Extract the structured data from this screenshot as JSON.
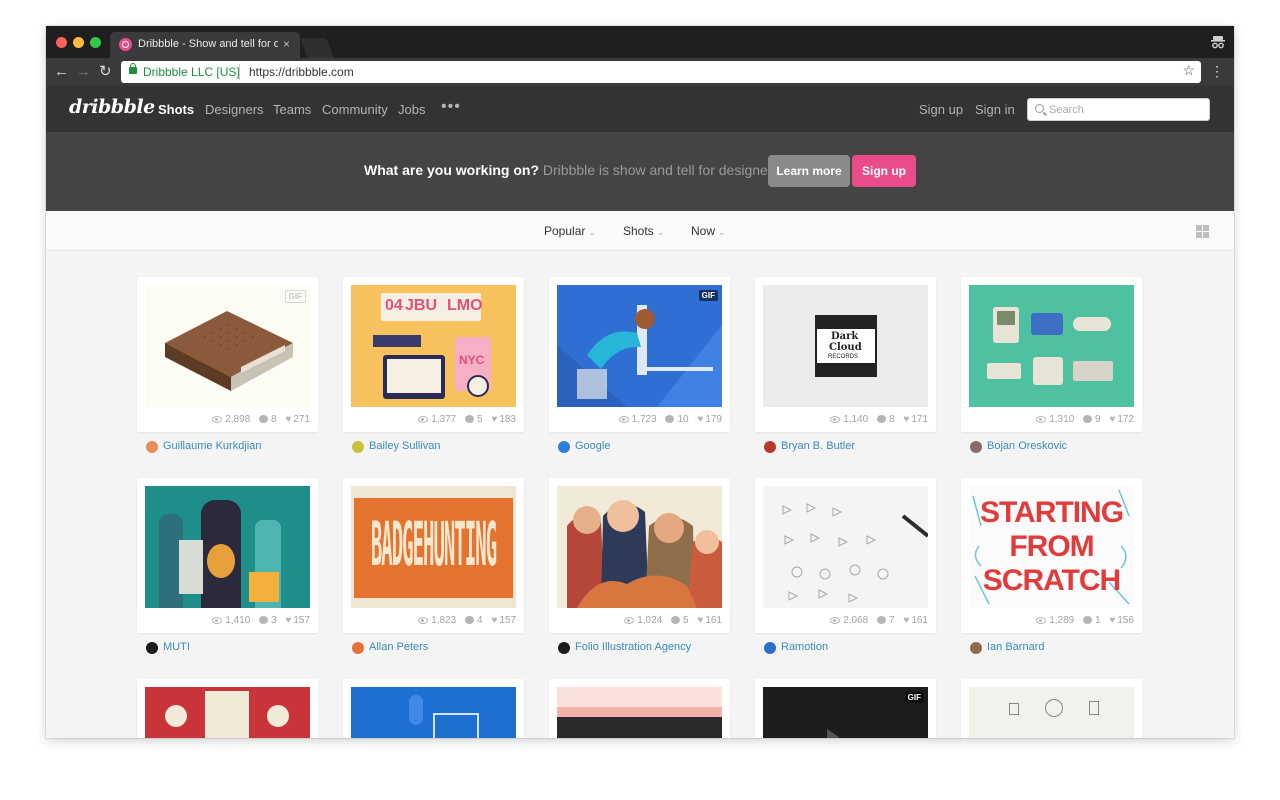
{
  "browser": {
    "tab_title": "Dribbble - Show and tell for de",
    "tab_close": "×",
    "url_owner": "Dribbble LLC [US]",
    "url": "https://dribbble.com",
    "back": "←",
    "forward": "→",
    "reload": "↻",
    "star": "☆",
    "menu": "⋮"
  },
  "header": {
    "logo": "dribbble",
    "nav": [
      "Shots",
      "Designers",
      "Teams",
      "Community",
      "Jobs"
    ],
    "more": "•••",
    "sign_up": "Sign up",
    "sign_in": "Sign in",
    "search_placeholder": "Search"
  },
  "hero": {
    "strong": "What are you working on?",
    "text": " Dribbble is show and tell for designers.",
    "learn_more": "Learn more",
    "sign_up": "Sign up"
  },
  "filters": {
    "sort": "Popular",
    "type": "Shots",
    "time": "Now",
    "caret": "⌄"
  },
  "gif_label": "GIF",
  "shots": [
    {
      "views": "2,898",
      "comments": "8",
      "likes": "271",
      "author": "Guillaume Kurkdjian",
      "gif": true,
      "avatar": "#e58e5a"
    },
    {
      "views": "1,377",
      "comments": "5",
      "likes": "183",
      "author": "Bailey Sullivan",
      "gif": false,
      "avatar": "#c9c23a"
    },
    {
      "views": "1,723",
      "comments": "10",
      "likes": "179",
      "author": "Google",
      "gif": true,
      "avatar": "#2f7fd6"
    },
    {
      "views": "1,140",
      "comments": "8",
      "likes": "171",
      "author": "Bryan B. Butler",
      "gif": false,
      "avatar": "#b43b2c"
    },
    {
      "views": "1,310",
      "comments": "9",
      "likes": "172",
      "author": "Bojan Oreskovic",
      "gif": false,
      "avatar": "#8c6a6a"
    },
    {
      "views": "1,410",
      "comments": "3",
      "likes": "157",
      "author": "MUTI",
      "gif": false,
      "avatar": "#1b1b1b"
    },
    {
      "views": "1,823",
      "comments": "4",
      "likes": "157",
      "author": "Allan Peters",
      "gif": false,
      "avatar": "#e8713a"
    },
    {
      "views": "1,024",
      "comments": "5",
      "likes": "161",
      "author": "Folio Illustration Agency",
      "gif": false,
      "avatar": "#1d1d1d"
    },
    {
      "views": "2,068",
      "comments": "7",
      "likes": "161",
      "author": "Ramotion",
      "gif": false,
      "avatar": "#2d6fc6"
    },
    {
      "views": "1,289",
      "comments": "1",
      "likes": "156",
      "author": "Ian Barnard",
      "gif": false,
      "avatar": "#8d6b50"
    }
  ],
  "thumb_text": {
    "jbu": "JBU",
    "lmo": "LMO",
    "nyc": "NYC",
    "num04": "04",
    "dark_cloud_1": "Dark",
    "dark_cloud_2": "Cloud",
    "dark_cloud_3": "RECORDS",
    "badgehunting": "BADGEHUNTING",
    "scratch_1": "STARTING",
    "scratch_2": "FROM",
    "scratch_3": "SCRATCH"
  },
  "colors": {
    "brand_pink": "#ea4c89",
    "header_bg": "#333333",
    "hero_bg": "#444444",
    "author_link": "#3a8bbb"
  }
}
